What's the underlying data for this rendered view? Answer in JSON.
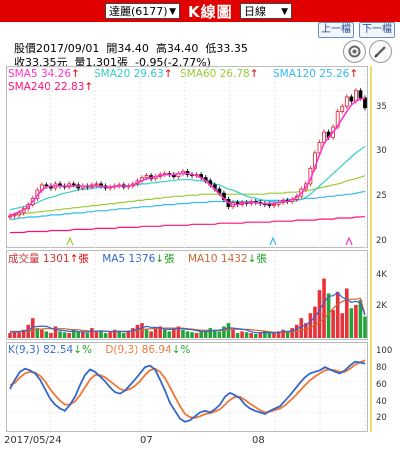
{
  "header": {
    "stock_select": "達麗(6177)",
    "title": "K線圖",
    "period_select": "日線",
    "prev_button": "上一檔",
    "next_button": "下一檔",
    "colors": {
      "bar": "#e00000",
      "up": "#e0192a",
      "down": "#1a9a1a"
    }
  },
  "quote": {
    "line1": [
      "股價2017/09/01",
      "開34.40",
      "高34.40",
      "低33.35"
    ],
    "line2": [
      "收33.35元",
      "量1,301張",
      "-0.95(-2.77%)"
    ]
  },
  "ma_legend": [
    {
      "label": "SMA5",
      "value": "34.26",
      "arrow": "↑",
      "color": "#ff33cc"
    },
    {
      "label": "SMA20",
      "value": "29.63",
      "arrow": "↑",
      "color": "#33cccc"
    },
    {
      "label": "SMA60",
      "value": "26.78",
      "arrow": "↑",
      "color": "#99cc33"
    },
    {
      "label": "SMA120",
      "value": "25.26",
      "arrow": "↑",
      "color": "#33bbee"
    },
    {
      "label": "SMA240",
      "value": "22.83",
      "arrow": "↑",
      "color": "#ff1177"
    }
  ],
  "volume_legend": [
    {
      "label": "成交量",
      "value": "1301",
      "arrow": "↑張",
      "color": "#cc3333"
    },
    {
      "label": "MA5",
      "value": "1376",
      "arrow": "↓張",
      "color": "#3366cc"
    },
    {
      "label": "MA10",
      "value": "1432",
      "arrow": "↓張",
      "color": "#cc6633"
    }
  ],
  "kd_legend": [
    {
      "label": "K(9,3)",
      "value": "82.54",
      "arrow": "↓%",
      "color": "#3366cc"
    },
    {
      "label": "D(9,3)",
      "value": "86.94",
      "arrow": "↓%",
      "color": "#ee7733"
    }
  ],
  "x_axis": [
    "2017/05/24",
    "07",
    "08"
  ],
  "chart_data": [
    {
      "type": "candlestick",
      "ylim": [
        20,
        37
      ],
      "y_ticks": [
        20,
        25,
        30,
        35
      ],
      "close": [
        22.9,
        23.0,
        23.2,
        23.6,
        24.0,
        24.6,
        25.4,
        25.9,
        25.8,
        25.6,
        26.0,
        25.8,
        25.7,
        26.0,
        25.9,
        25.6,
        25.8,
        25.7,
        25.9,
        26.0,
        25.8,
        25.6,
        25.7,
        25.8,
        25.9,
        25.7,
        25.8,
        26.0,
        26.3,
        26.6,
        26.8,
        26.5,
        26.7,
        26.9,
        27.0,
        26.9,
        26.7,
        27.0,
        27.2,
        26.9,
        26.8,
        26.9,
        26.6,
        26.3,
        25.9,
        25.5,
        25.1,
        24.5,
        23.8,
        24.2,
        24.0,
        24.2,
        24.1,
        24.3,
        24.2,
        24.1,
        24.0,
        23.9,
        24.0,
        24.2,
        24.4,
        24.3,
        24.5,
        24.8,
        25.5,
        26.0,
        27.5,
        29.0,
        30.0,
        31.0,
        30.5,
        31.5,
        33.0,
        33.5,
        34.4,
        34.0,
        35.0,
        34.3,
        33.35
      ],
      "sma5": [
        23.0,
        23.1,
        23.3,
        23.5,
        23.8,
        24.3,
        24.9,
        25.4,
        25.7,
        25.8,
        25.8,
        25.8,
        25.8,
        25.8,
        25.8,
        25.8,
        25.8,
        25.8,
        25.8,
        25.8,
        25.8,
        25.7,
        25.7,
        25.7,
        25.8,
        25.8,
        25.8,
        25.9,
        26.1,
        26.3,
        26.5,
        26.6,
        26.7,
        26.8,
        26.9,
        26.9,
        26.9,
        27.0,
        27.0,
        27.0,
        26.9,
        26.8,
        26.6,
        26.3,
        25.9,
        25.5,
        25.0,
        24.6,
        24.2,
        24.0,
        24.0,
        24.1,
        24.2,
        24.2,
        24.2,
        24.1,
        24.1,
        24.1,
        24.1,
        24.2,
        24.3,
        24.3,
        24.5,
        24.7,
        25.1,
        25.7,
        26.4,
        27.6,
        28.8,
        29.9,
        30.5,
        31.0,
        31.6,
        32.3,
        33.0,
        33.6,
        34.0,
        34.2,
        34.26
      ],
      "sma20": [
        23.5,
        23.6,
        23.7,
        23.8,
        23.9,
        24.0,
        24.2,
        24.4,
        24.6,
        24.7,
        24.8,
        25.0,
        25.1,
        25.2,
        25.3,
        25.4,
        25.5,
        25.5,
        25.6,
        25.6,
        25.7,
        25.7,
        25.7,
        25.8,
        25.8,
        25.8,
        25.8,
        25.9,
        25.9,
        26.0,
        26.0,
        26.1,
        26.1,
        26.2,
        26.2,
        26.3,
        26.3,
        26.4,
        26.4,
        26.4,
        26.4,
        26.3,
        26.3,
        26.2,
        26.1,
        26.0,
        25.9,
        25.7,
        25.5,
        25.4,
        25.2,
        25.0,
        24.8,
        24.7,
        24.6,
        24.5,
        24.4,
        24.3,
        24.3,
        24.2,
        24.2,
        24.3,
        24.3,
        24.4,
        24.5,
        24.7,
        25.0,
        25.4,
        25.8,
        26.2,
        26.6,
        27.0,
        27.4,
        27.8,
        28.2,
        28.6,
        29.0,
        29.3,
        29.63
      ],
      "sma60": [
        23.0,
        23.0,
        23.1,
        23.1,
        23.2,
        23.2,
        23.3,
        23.3,
        23.4,
        23.4,
        23.5,
        23.5,
        23.6,
        23.6,
        23.7,
        23.7,
        23.8,
        23.8,
        23.9,
        23.9,
        24.0,
        24.0,
        24.1,
        24.1,
        24.2,
        24.2,
        24.3,
        24.3,
        24.4,
        24.4,
        24.5,
        24.5,
        24.6,
        24.6,
        24.7,
        24.7,
        24.8,
        24.8,
        24.8,
        24.9,
        24.9,
        24.9,
        25.0,
        25.0,
        25.0,
        25.0,
        25.0,
        25.0,
        25.0,
        25.0,
        25.0,
        25.0,
        25.0,
        25.0,
        25.0,
        25.0,
        25.0,
        25.1,
        25.1,
        25.1,
        25.1,
        25.2,
        25.2,
        25.2,
        25.3,
        25.3,
        25.4,
        25.5,
        25.6,
        25.7,
        25.8,
        25.9,
        26.0,
        26.1,
        26.3,
        26.4,
        26.5,
        26.65,
        26.78
      ],
      "sma120": [
        22.6,
        22.6,
        22.7,
        22.7,
        22.8,
        22.8,
        22.8,
        22.9,
        22.9,
        23.0,
        23.0,
        23.0,
        23.1,
        23.1,
        23.2,
        23.2,
        23.2,
        23.3,
        23.3,
        23.4,
        23.4,
        23.4,
        23.5,
        23.5,
        23.6,
        23.6,
        23.6,
        23.7,
        23.7,
        23.8,
        23.8,
        23.8,
        23.9,
        23.9,
        24.0,
        24.0,
        24.0,
        24.1,
        24.1,
        24.1,
        24.2,
        24.2,
        24.2,
        24.2,
        24.3,
        24.3,
        24.3,
        24.3,
        24.3,
        24.3,
        24.3,
        24.3,
        24.3,
        24.3,
        24.3,
        24.4,
        24.4,
        24.4,
        24.4,
        24.4,
        24.4,
        24.5,
        24.5,
        24.5,
        24.5,
        24.6,
        24.6,
        24.6,
        24.7,
        24.7,
        24.8,
        24.8,
        24.9,
        24.9,
        25.0,
        25.0,
        25.1,
        25.2,
        25.26
      ],
      "sma240": [
        21.3,
        21.3,
        21.3,
        21.3,
        21.4,
        21.4,
        21.4,
        21.4,
        21.4,
        21.5,
        21.5,
        21.5,
        21.5,
        21.5,
        21.6,
        21.6,
        21.6,
        21.6,
        21.6,
        21.7,
        21.7,
        21.7,
        21.7,
        21.7,
        21.8,
        21.8,
        21.8,
        21.8,
        21.8,
        21.9,
        21.9,
        21.9,
        21.9,
        21.9,
        22.0,
        22.0,
        22.0,
        22.0,
        22.0,
        22.0,
        22.1,
        22.1,
        22.1,
        22.1,
        22.1,
        22.1,
        22.2,
        22.2,
        22.2,
        22.2,
        22.2,
        22.2,
        22.3,
        22.3,
        22.3,
        22.3,
        22.3,
        22.3,
        22.4,
        22.4,
        22.4,
        22.4,
        22.4,
        22.5,
        22.5,
        22.5,
        22.5,
        22.5,
        22.6,
        22.6,
        22.6,
        22.6,
        22.7,
        22.7,
        22.7,
        22.7,
        22.8,
        22.8,
        22.83
      ]
    },
    {
      "type": "bar",
      "ylim": [
        0,
        4600
      ],
      "y_ticks": [
        "4K",
        "2K"
      ],
      "values": [
        300,
        400,
        350,
        500,
        800,
        1200,
        600,
        500,
        400,
        300,
        700,
        400,
        350,
        300,
        500,
        400,
        350,
        300,
        600,
        400,
        450,
        300,
        350,
        500,
        400,
        300,
        450,
        600,
        800,
        900,
        500,
        400,
        600,
        700,
        500,
        400,
        600,
        700,
        500,
        400,
        350,
        300,
        400,
        500,
        600,
        500,
        400,
        700,
        900,
        500,
        300,
        400,
        350,
        300,
        250,
        300,
        400,
        350,
        300,
        400,
        500,
        350,
        600,
        800,
        1200,
        900,
        1500,
        1900,
        2900,
        3600,
        2700,
        1700,
        2800,
        1500,
        3000,
        1800,
        2000,
        2300,
        1301
      ],
      "up": [
        true,
        true,
        true,
        true,
        true,
        true,
        false,
        true,
        false,
        true,
        true,
        false,
        false,
        true,
        false,
        false,
        true,
        false,
        true,
        true,
        false,
        false,
        true,
        true,
        false,
        false,
        true,
        true,
        true,
        true,
        false,
        true,
        true,
        true,
        false,
        false,
        true,
        true,
        false,
        false,
        false,
        true,
        false,
        false,
        false,
        false,
        false,
        false,
        false,
        true,
        false,
        true,
        false,
        true,
        false,
        true,
        false,
        false,
        true,
        true,
        true,
        false,
        true,
        true,
        true,
        true,
        true,
        true,
        true,
        true,
        false,
        true,
        true,
        true,
        true,
        false,
        true,
        false,
        false
      ],
      "ma5": [
        350,
        360,
        380,
        420,
        470,
        650,
        700,
        720,
        700,
        600,
        500,
        480,
        450,
        400,
        420,
        390,
        370,
        360,
        410,
        420,
        430,
        410,
        380,
        380,
        400,
        380,
        390,
        450,
        520,
        620,
        700,
        650,
        640,
        620,
        540,
        520,
        540,
        580,
        560,
        520,
        500,
        450,
        400,
        380,
        420,
        460,
        480,
        540,
        620,
        600,
        570,
        540,
        480,
        380,
        320,
        320,
        330,
        320,
        320,
        340,
        380,
        400,
        430,
        530,
        690,
        770,
        1000,
        1260,
        1680,
        2160,
        2520,
        2560,
        2740,
        2460,
        2340,
        2160,
        2220,
        2120,
        1376
      ],
      "ma10": [
        400,
        400,
        400,
        410,
        420,
        480,
        520,
        540,
        560,
        570,
        560,
        560,
        560,
        520,
        510,
        500,
        460,
        430,
        400,
        420,
        420,
        410,
        400,
        400,
        410,
        410,
        410,
        430,
        460,
        500,
        540,
        560,
        580,
        600,
        600,
        600,
        600,
        600,
        600,
        560,
        540,
        500,
        480,
        460,
        450,
        450,
        460,
        480,
        510,
        530,
        530,
        520,
        520,
        500,
        470,
        450,
        420,
        380,
        350,
        330,
        340,
        350,
        370,
        410,
        480,
        540,
        640,
        780,
        950,
        1170,
        1440,
        1800,
        2050,
        2200,
        2350,
        2350,
        2350,
        2400,
        1432
      ]
    },
    {
      "type": "line",
      "ylim": [
        0,
        100
      ],
      "y_ticks": [
        20,
        40,
        60,
        80,
        100
      ],
      "k": [
        50,
        62,
        72,
        76,
        74,
        70,
        62,
        50,
        38,
        30,
        25,
        22,
        30,
        40,
        55,
        68,
        75,
        72,
        66,
        60,
        52,
        46,
        44,
        48,
        55,
        62,
        70,
        78,
        80,
        75,
        62,
        48,
        32,
        22,
        12,
        8,
        10,
        15,
        20,
        22,
        20,
        24,
        30,
        40,
        45,
        42,
        38,
        30,
        25,
        22,
        20,
        18,
        22,
        25,
        28,
        35,
        42,
        50,
        58,
        65,
        70,
        72,
        74,
        78,
        75,
        72,
        70,
        74,
        80,
        85,
        84,
        82.54
      ],
      "d": [
        55,
        58,
        65,
        70,
        72,
        71,
        67,
        60,
        50,
        42,
        35,
        30,
        30,
        34,
        42,
        52,
        62,
        68,
        68,
        65,
        60,
        55,
        50,
        48,
        50,
        54,
        60,
        68,
        74,
        76,
        72,
        64,
        52,
        40,
        28,
        18,
        14,
        13,
        15,
        18,
        19,
        21,
        24,
        30,
        36,
        40,
        40,
        36,
        31,
        27,
        23,
        20,
        21,
        23,
        25,
        29,
        35,
        41,
        48,
        55,
        61,
        66,
        70,
        74,
        75,
        74,
        72,
        72,
        76,
        81,
        84,
        86.94
      ]
    }
  ]
}
